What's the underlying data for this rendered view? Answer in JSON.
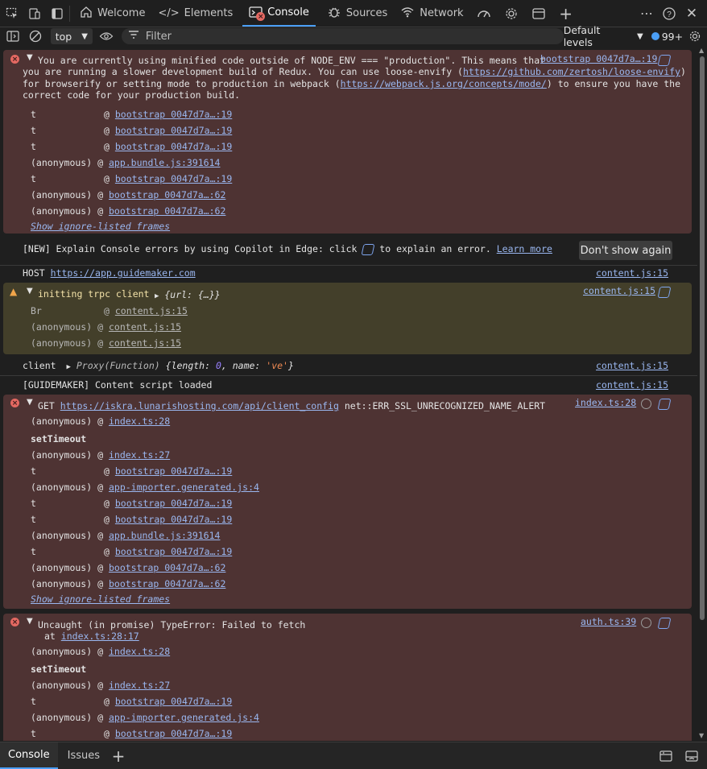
{
  "tabs": {
    "welcome": "Welcome",
    "elements": "Elements",
    "console": "Console",
    "sources": "Sources",
    "network": "Network"
  },
  "toolbar": {
    "context": "top",
    "filter_placeholder": "Filter",
    "levels": "Default levels",
    "issues_count": "99+"
  },
  "messages": {
    "m1": {
      "text_l1": "You are currently using minified code outside of NODE_ENV === \"production\". This means that",
      "text_l2a": "you are running a slower development build of Redux. You can use loose-envify (",
      "text_l2link": "https://github.com/zertosh/loose-envify",
      "text_l2b": ")",
      "text_l3a": "for browserify or setting mode to production in webpack (",
      "text_l3link": "https://webpack.js.org/concepts/mode/",
      "text_l3b": ") to ensure you have the",
      "text_l4": "correct code for your production build.",
      "source": "bootstrap 0047d7a…:19",
      "frames": [
        {
          "fn": "t",
          "at": "@",
          "src": "bootstrap 0047d7a…:19"
        },
        {
          "fn": "t",
          "at": "@",
          "src": "bootstrap 0047d7a…:19"
        },
        {
          "fn": "t",
          "at": "@",
          "src": "bootstrap 0047d7a…:19"
        },
        {
          "fn": "(anonymous)",
          "at": "@",
          "src": "app.bundle.js:391614"
        },
        {
          "fn": "t",
          "at": "@",
          "src": "bootstrap 0047d7a…:19"
        },
        {
          "fn": "(anonymous)",
          "at": "@",
          "src": "bootstrap 0047d7a…:62"
        },
        {
          "fn": "(anonymous)",
          "at": "@",
          "src": "bootstrap 0047d7a…:62"
        }
      ],
      "show_ignore": "Show ignore-listed frames"
    },
    "copilot": {
      "text_a": "[NEW] Explain Console errors by using Copilot in Edge: click",
      "text_b": "to explain an error.",
      "learn_more": "Learn more",
      "dont_show": "Don't show again"
    },
    "host": {
      "label": "HOST",
      "url": "https://app.guidemaker.com",
      "source": "content.js:15"
    },
    "warn": {
      "text": "initting trpc client",
      "obj": "{url: {…}}",
      "source": "content.js:15",
      "frames": [
        {
          "fn": "Br",
          "at": "@",
          "src": "content.js:15"
        },
        {
          "fn": "(anonymous)",
          "at": "@",
          "src": "content.js:15"
        },
        {
          "fn": "(anonymous)",
          "at": "@",
          "src": "content.js:15"
        }
      ]
    },
    "client": {
      "label": "client",
      "proxy": "Proxy(Function)",
      "obj_a": "{length: ",
      "obj_num": "0",
      "obj_b": ", name: ",
      "obj_str": "'ve'",
      "obj_c": "}",
      "source": "content.js:15"
    },
    "guidemaker": {
      "text": "[GUIDEMAKER] Content script loaded",
      "source": "content.js:15"
    },
    "m2": {
      "method": "GET",
      "url": "https://iskra.lunarishosting.com/api/client_config",
      "err": "net::ERR_SSL_UNRECOGNIZED_NAME_ALERT",
      "source": "index.ts:28",
      "frames": [
        {
          "fn": "(anonymous)",
          "at": "@",
          "src": "index.ts:28"
        },
        {
          "fn": "setTimeout",
          "at": "",
          "src": ""
        },
        {
          "fn": "(anonymous)",
          "at": "@",
          "src": "index.ts:27"
        },
        {
          "fn": "t",
          "at": "@",
          "src": "bootstrap 0047d7a…:19"
        },
        {
          "fn": "(anonymous)",
          "at": "@",
          "src": "app-importer.generated.js:4"
        },
        {
          "fn": "t",
          "at": "@",
          "src": "bootstrap 0047d7a…:19"
        },
        {
          "fn": "t",
          "at": "@",
          "src": "bootstrap 0047d7a…:19"
        },
        {
          "fn": "(anonymous)",
          "at": "@",
          "src": "app.bundle.js:391614"
        },
        {
          "fn": "t",
          "at": "@",
          "src": "bootstrap 0047d7a…:19"
        },
        {
          "fn": "(anonymous)",
          "at": "@",
          "src": "bootstrap 0047d7a…:62"
        },
        {
          "fn": "(anonymous)",
          "at": "@",
          "src": "bootstrap 0047d7a…:62"
        }
      ],
      "show_ignore": "Show ignore-listed frames"
    },
    "m3": {
      "text": "Uncaught (in promise) TypeError: Failed to fetch",
      "at_label": "at",
      "at_link": "index.ts:28:17",
      "source": "auth.ts:39",
      "frames": [
        {
          "fn": "(anonymous)",
          "at": "@",
          "src": "index.ts:28"
        },
        {
          "fn": "setTimeout",
          "at": "",
          "src": ""
        },
        {
          "fn": "(anonymous)",
          "at": "@",
          "src": "index.ts:27"
        },
        {
          "fn": "t",
          "at": "@",
          "src": "bootstrap 0047d7a…:19"
        },
        {
          "fn": "(anonymous)",
          "at": "@",
          "src": "app-importer.generated.js:4"
        },
        {
          "fn": "t",
          "at": "@",
          "src": "bootstrap 0047d7a…:19"
        }
      ]
    }
  },
  "drawer": {
    "console": "Console",
    "issues": "Issues"
  },
  "colors": {
    "error_bg": "#4e3333",
    "warn_bg": "#433f2a",
    "link": "#9ab7f0",
    "accent": "#4a9ef5"
  }
}
